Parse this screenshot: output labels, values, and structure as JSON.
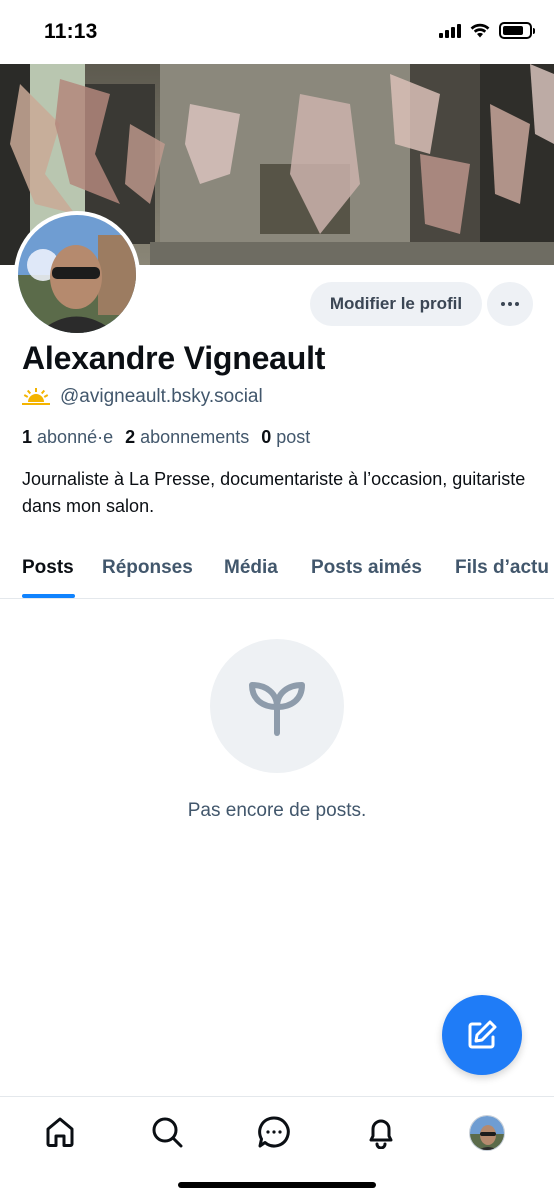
{
  "status_bar": {
    "time": "11:13",
    "icons": [
      "cellular-signal-icon",
      "wifi-icon",
      "battery-icon"
    ]
  },
  "profile": {
    "display_name": "Alexandre Vigneault",
    "handle": "@avigneault.bsky.social",
    "handle_badge_icon": "sunrise-icon",
    "followers_count": "1",
    "followers_label": "abonné·e",
    "following_count": "2",
    "following_label": "abonnements",
    "posts_count": "0",
    "posts_label": "post",
    "bio": "Journaliste à La Presse, documentariste à l’occasion, guitariste dans mon salon."
  },
  "actions": {
    "edit_profile_label": "Modifier le profil",
    "more_icon": "ellipsis-icon"
  },
  "tabs": [
    {
      "label": "Posts",
      "active": true
    },
    {
      "label": "Réponses",
      "active": false
    },
    {
      "label": "Média",
      "active": false
    },
    {
      "label": "Posts aimés",
      "active": false
    },
    {
      "label": "Fils d’actu",
      "active": false
    }
  ],
  "empty_state": {
    "icon": "seedling-icon",
    "message": "Pas encore de posts."
  },
  "compose_button": {
    "icon": "compose-icon"
  },
  "bottom_nav": {
    "items": [
      {
        "name": "home",
        "icon": "home-icon"
      },
      {
        "name": "search",
        "icon": "search-icon"
      },
      {
        "name": "chat",
        "icon": "chat-icon"
      },
      {
        "name": "notifications",
        "icon": "bell-icon"
      },
      {
        "name": "profile",
        "icon": "avatar"
      }
    ]
  },
  "colors": {
    "accent": "#1083fe",
    "fab": "#1f7cf7",
    "text_primary": "#0b0f14",
    "text_secondary": "#42576c",
    "button_bg": "#eef1f5",
    "divider": "#e4e8ec"
  }
}
